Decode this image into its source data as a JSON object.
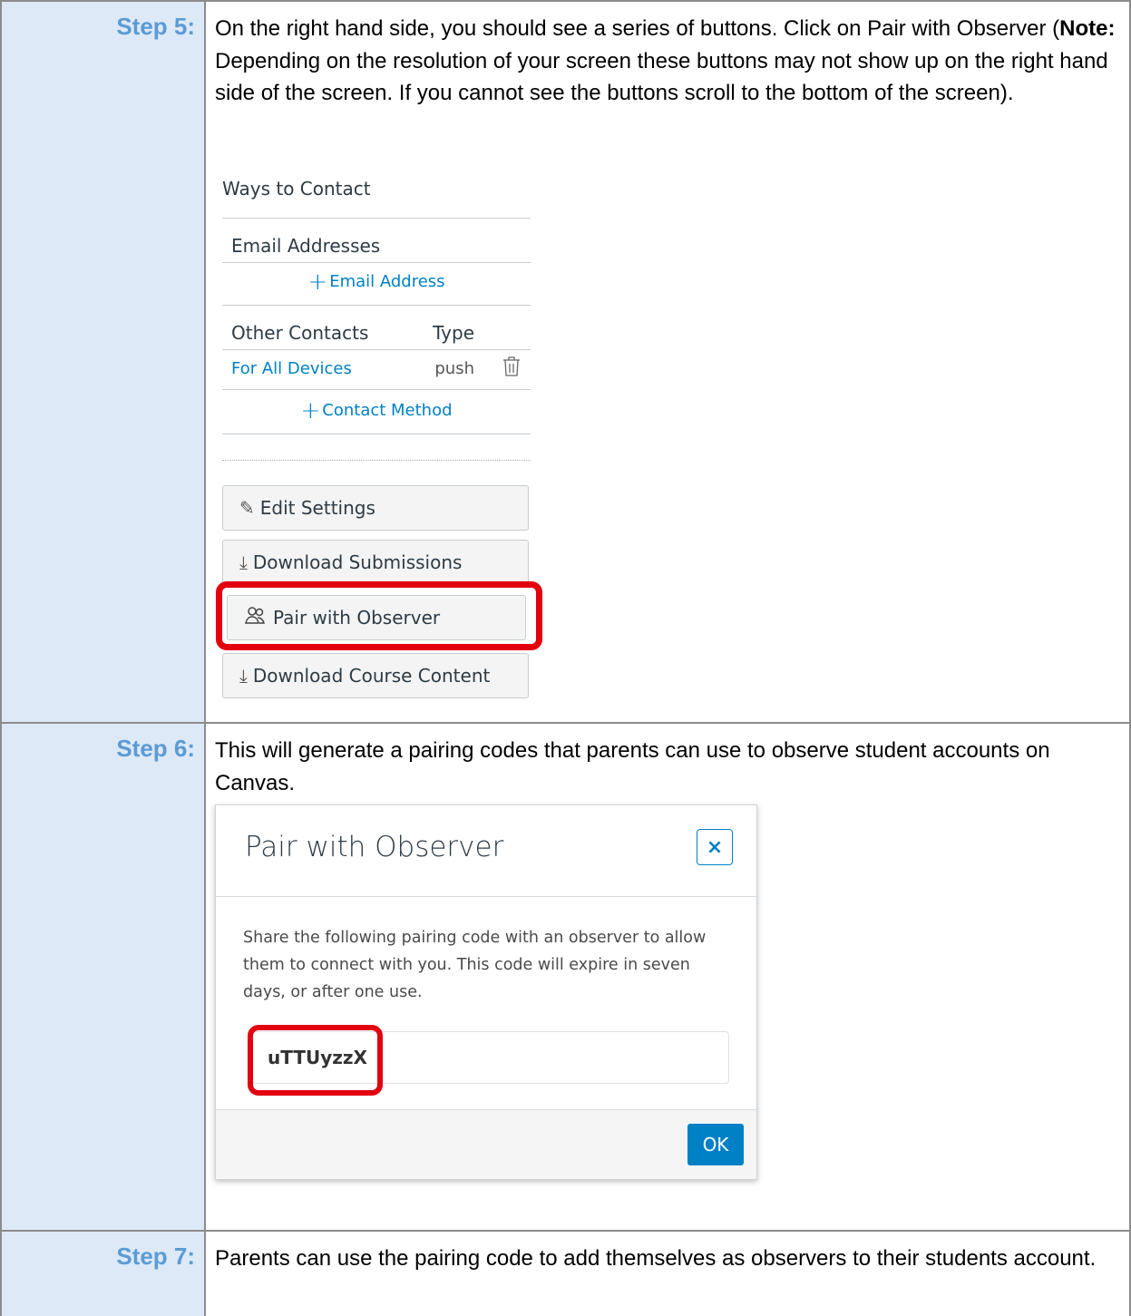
{
  "steps": [
    {
      "label": "Step 5:",
      "text_parts": {
        "a": "On the right hand side, you should see a series of buttons.  Click on Pair with Observer (",
        "note": "Note:",
        "b": "  Depending on the resolution of your screen these buttons may not show up on the right hand side of the screen.  If you cannot see the buttons scroll to the bottom of the screen)."
      }
    },
    {
      "label": "Step 6:",
      "text": "This will generate a pairing codes that parents can use to observe student accounts on Canvas."
    },
    {
      "label": "Step 7:",
      "text": "Parents can use the pairing code to add themselves as observers to their students account."
    }
  ],
  "contact_panel": {
    "title": "Ways to Contact",
    "email_header": "Email Addresses",
    "add_email": "Email Address",
    "other_header": "Other Contacts",
    "type_header": "Type",
    "contact_name": "For All Devices",
    "contact_type": "push",
    "add_contact": "Contact Method"
  },
  "buttons": {
    "edit_settings": "Edit Settings",
    "download_submissions": "Download Submissions",
    "pair_with_observer": "Pair with Observer",
    "download_course_content": "Download Course Content"
  },
  "modal": {
    "title": "Pair with Observer",
    "close": "×",
    "body": "Share the following pairing code with an observer to allow them to connect with you. This code will expire in seven days, or after one use.",
    "code": "uTTUyzzX",
    "ok": "OK"
  },
  "colors": {
    "step_label": "#5b9bd5",
    "label_bg": "#dde9f6",
    "highlight": "#e3000f",
    "canvas_blue": "#0081c6"
  }
}
